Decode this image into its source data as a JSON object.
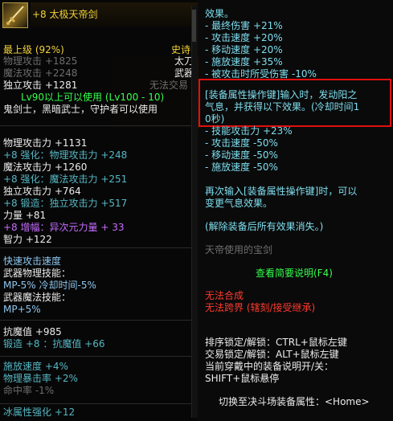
{
  "item": {
    "name": "+8 太极天帝剑",
    "grade": "最上级 (92%)",
    "rarity": "史诗",
    "type1": "太刀",
    "type2": "武器",
    "phys_atk": "物理攻击 +1825",
    "mag_atk": "魔法攻击 +2248",
    "indep_atk": "独立攻击 +1281",
    "no_trade": "无法交易",
    "level_req": "Lv90以上可以使用 (Lv100 - 10)",
    "classes": "鬼剑士，黑暗武士，守护者可以使用"
  },
  "stats": [
    {
      "text": "物理攻击力 +1131",
      "color": "white"
    },
    {
      "text": "+8 强化：物理攻击力 +248",
      "color": "teal"
    },
    {
      "text": "魔法攻击力 +1260",
      "color": "white"
    },
    {
      "text": "+8 强化：魔法攻击力 +251",
      "color": "teal"
    },
    {
      "text": "独立攻击力 +764",
      "color": "white"
    },
    {
      "text": "+8 锻造：独立攻击力 +517",
      "color": "teal"
    },
    {
      "text": "力量 +81",
      "color": "white"
    },
    {
      "text": "+8 增幅：异次元力量 + 33",
      "color": "purple"
    },
    {
      "text": "智力 +122",
      "color": "white"
    }
  ],
  "skills": [
    {
      "text": "快速攻击速度",
      "color": "lblue"
    },
    {
      "text": "武器物理技能：",
      "color": "white"
    },
    {
      "text": " MP-5% 冷却时间-5%",
      "color": "lblue"
    },
    {
      "text": "武器魔法技能：",
      "color": "white"
    },
    {
      "text": " MP+5%",
      "color": "lblue"
    }
  ],
  "defense": [
    {
      "text": "抗魔值 +985",
      "color": "white"
    },
    {
      "text": "锻造 +8 ：抗魔值 +66",
      "color": "teal"
    }
  ],
  "speed": [
    {
      "text": "施放速度 +4%",
      "color": "teal"
    },
    {
      "text": "物理暴击率 +2%",
      "color": "teal"
    },
    {
      "text": "命中率 -1%",
      "color": "dgray"
    }
  ],
  "element": {
    "text": "冰属性强化 +12",
    "color": "teal"
  },
  "effect": {
    "header": "效果。",
    "buffs": [
      "- 最终伤害 +21%",
      "- 攻击速度 +20%",
      "- 移动速度 +20%",
      "- 施放速度 +35%",
      "- 被攻击时所受伤害 -10%"
    ],
    "highlight": [
      "[装备属性操作键]输入时，发动阳之",
      "气息，并获得以下效果。(冷却时间1",
      "0秒)"
    ],
    "yang_buffs": [
      "- 技能攻击力 +23%",
      "- 攻击速度 -50%",
      "- 移动速度 -50%",
      "- 施放速度 -50%"
    ],
    "reinput": [
      "再次输入[装备属性操作键]时，可以",
      "变更气息效果。"
    ],
    "unequip": "(解除装备后所有效果消失。)",
    "flavor": "天帝使用的宝剑",
    "view_desc": "查看简要说明(F4)",
    "no_synth": "无法合成",
    "no_cross": "无法跨界 (辖刻/接受继承)",
    "lock1": "排序锁定/解锁：CTRL+鼠标左键",
    "lock2": "交易锁定/解锁：ALT+鼠标左键",
    "desc_toggle1": "当前穿戴中的装备说明开/关：",
    "desc_toggle2": "SHIFT+鼠标悬停",
    "switch": "切换至决斗场装备属性：<Home>"
  },
  "icons": {
    "weapon": "sword-icon"
  },
  "colors": {
    "highlight_border": "#e01010",
    "rarity": "#f2d23a",
    "stat_teal": "#56b7c4",
    "buff_cyan": "#7fdff0",
    "green": "#35ff4d",
    "red": "#ff3a2e",
    "purple": "#c66cff"
  }
}
